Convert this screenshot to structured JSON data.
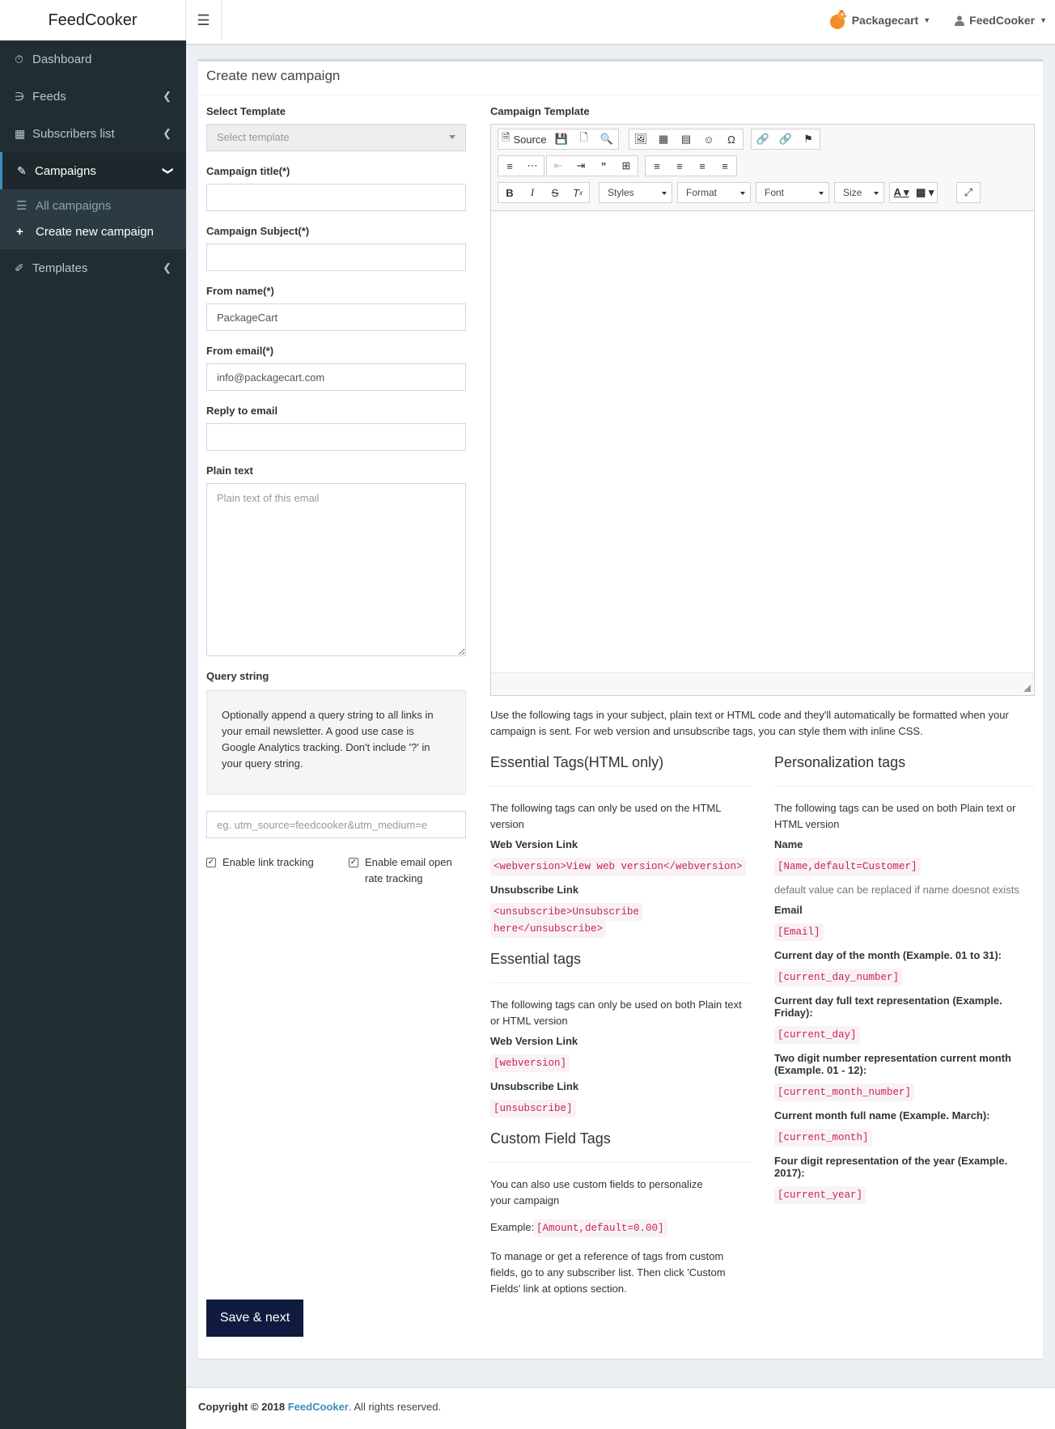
{
  "header": {
    "brand": "FeedCooker",
    "account_label": "Packagecart",
    "user_label": "FeedCooker"
  },
  "sidebar": {
    "items": [
      {
        "label": "Dashboard",
        "icon": "dashboard-icon"
      },
      {
        "label": "Feeds",
        "icon": "rss-icon"
      },
      {
        "label": "Subscribers list",
        "icon": "grid-icon"
      },
      {
        "label": "Campaigns",
        "icon": "pencil-icon"
      },
      {
        "label": "Templates",
        "icon": "brush-icon"
      }
    ],
    "campaigns_sub": [
      {
        "label": "All campaigns",
        "icon": "list-icon"
      },
      {
        "label": "Create new campaign",
        "icon": "plus-icon"
      }
    ]
  },
  "page": {
    "title": "Create new campaign"
  },
  "form": {
    "select_template_label": "Select Template",
    "select_template_value": "Select template",
    "campaign_title_label": "Campaign title(*)",
    "campaign_title_value": "",
    "campaign_subject_label": "Campaign Subject(*)",
    "campaign_subject_value": "",
    "from_name_label": "From name(*)",
    "from_name_value": "PackageCart",
    "from_email_label": "From email(*)",
    "from_email_value": "info@packagecart.com",
    "reply_to_label": "Reply to email",
    "reply_to_value": "",
    "plain_text_label": "Plain text",
    "plain_text_placeholder": "Plain text of this email",
    "query_string_label": "Query string",
    "query_string_help": "Optionally append a query string to all links in your email newsletter. A good use case is Google Analytics tracking. Don't include '?' in your query string.",
    "query_string_placeholder": "eg. utm_source=feedcooker&utm_medium=e",
    "link_tracking_label": "Enable link tracking",
    "link_tracking_checked": true,
    "open_tracking_label": "Enable email open rate tracking",
    "open_tracking_checked": true,
    "save_label": "Save & next"
  },
  "editor": {
    "label": "Campaign Template",
    "source_label": "Source",
    "styles_label": "Styles",
    "format_label": "Format",
    "font_label": "Font",
    "size_label": "Size"
  },
  "tags": {
    "intro": "Use the following tags in your subject, plain text or HTML code and they'll automatically be formatted when your campaign is sent. For web version and unsubscribe tags, you can style them with inline CSS.",
    "essential_html": {
      "heading": "Essential Tags(HTML only)",
      "desc": "The following tags can only be used on the HTML version",
      "web_label": "Web Version Link",
      "web_code": "<webversion>View web version</webversion>",
      "unsub_label": "Unsubscribe Link",
      "unsub_code_1": "<unsubscribe>Unsubscribe",
      "unsub_code_2": "here</unsubscribe>"
    },
    "essential": {
      "heading": "Essential tags",
      "desc": "The following tags can only be used on both Plain text or HTML version",
      "web_label": "Web Version Link",
      "web_code": "[webversion]",
      "unsub_label": "Unsubscribe Link",
      "unsub_code": "[unsubscribe]"
    },
    "custom": {
      "heading": "Custom Field Tags",
      "desc": "You can also use custom fields to personalize your campaign",
      "example_label": "Example:",
      "example_code": "[Amount,default=0.00]",
      "manage": "To manage or get a reference of tags from custom fields, go to any subscriber list. Then click 'Custom Fields' link at options section."
    },
    "personalization": {
      "heading": "Personalization tags",
      "desc": "The following tags can be used on both Plain text or HTML version",
      "name_label": "Name",
      "name_code": "[Name,default=Customer]",
      "name_note": "default value can be replaced if name doesnot exists",
      "email_label": "Email",
      "email_code": "[Email]",
      "day_num_label": "Current day of the month (Example. 01 to 31):",
      "day_num_code": "[current_day_number]",
      "day_full_label_1": "Current day full text representation (Example.",
      "day_full_label_2": "Friday):",
      "day_full_code": "[current_day]",
      "month_num_label_1": "Two digit number representation current month",
      "month_num_label_2": "(Example. 01 - 12):",
      "month_num_code": "[current_month_number]",
      "month_label": "Current month full name (Example. March):",
      "month_code": "[current_month]",
      "year_label_1": "Four digit representation of the year (Example.",
      "year_label_2": "2017):",
      "year_code": "[current_year]"
    }
  },
  "footer": {
    "copyright": "Copyright © 2018",
    "brand_link": "FeedCooker",
    "rights": ". All rights reserved."
  }
}
